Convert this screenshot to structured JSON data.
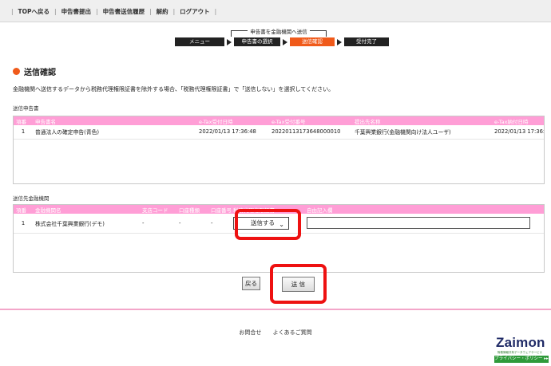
{
  "nav": {
    "items": [
      "TOPへ戻る",
      "申告書提出",
      "申告書送信履歴",
      "解約",
      "ログアウト"
    ],
    "separator": "|"
  },
  "flow": {
    "caption": "申告書を金融機関へ送信",
    "steps": [
      "メニュー",
      "申告書の選択",
      "送信確認",
      "受付完了"
    ]
  },
  "heading": "送信確認",
  "instruction": "金融機関へ送信するデータから税務代理権限証書を除外する場合、「税務代理権限証書」で「送信しない」を選択してください。",
  "declarations": {
    "label": "送信申告書",
    "columns": [
      "項番",
      "申告書名",
      "",
      "e-Tax受付日時",
      "e-Tax受付番号",
      "",
      "提出先名称",
      "e-Tax納付日時"
    ],
    "rows": [
      [
        "1",
        "普通法人の確定申告(青色)",
        "",
        "2022/01/13 17:36:48",
        "20220113173648000010",
        "",
        "千葉興業銀行(金融機関向け法人ユーザ)",
        "2022/01/13 17:36:48"
      ]
    ]
  },
  "institutions": {
    "label": "送信先金融機関",
    "columns": [
      "項番",
      "金融機関名",
      "支店コード",
      "口座種類",
      "口座番号",
      "税務代理権限証書",
      "自由記入欄"
    ],
    "rows": [
      {
        "no": "1",
        "name": "株式会社千葉興業銀行(デモ)",
        "branch": "-",
        "type": "-",
        "account": "-",
        "select": "送信する",
        "memo": ""
      }
    ]
  },
  "buttons": {
    "back": "戻る",
    "send": "送 信"
  },
  "footer": [
    "お問合せ",
    "よくあるご質問"
  ],
  "logo": {
    "name": "Zaimon",
    "tagline": "財務情報共有データウェアサービス",
    "link": "プライバシー・ポリシー ▸▸"
  },
  "colors": {
    "accent": "#f05a1a",
    "table_header": "#ff9ed6",
    "highlight": "#ee1111",
    "logo_green": "#2f9a3a"
  }
}
